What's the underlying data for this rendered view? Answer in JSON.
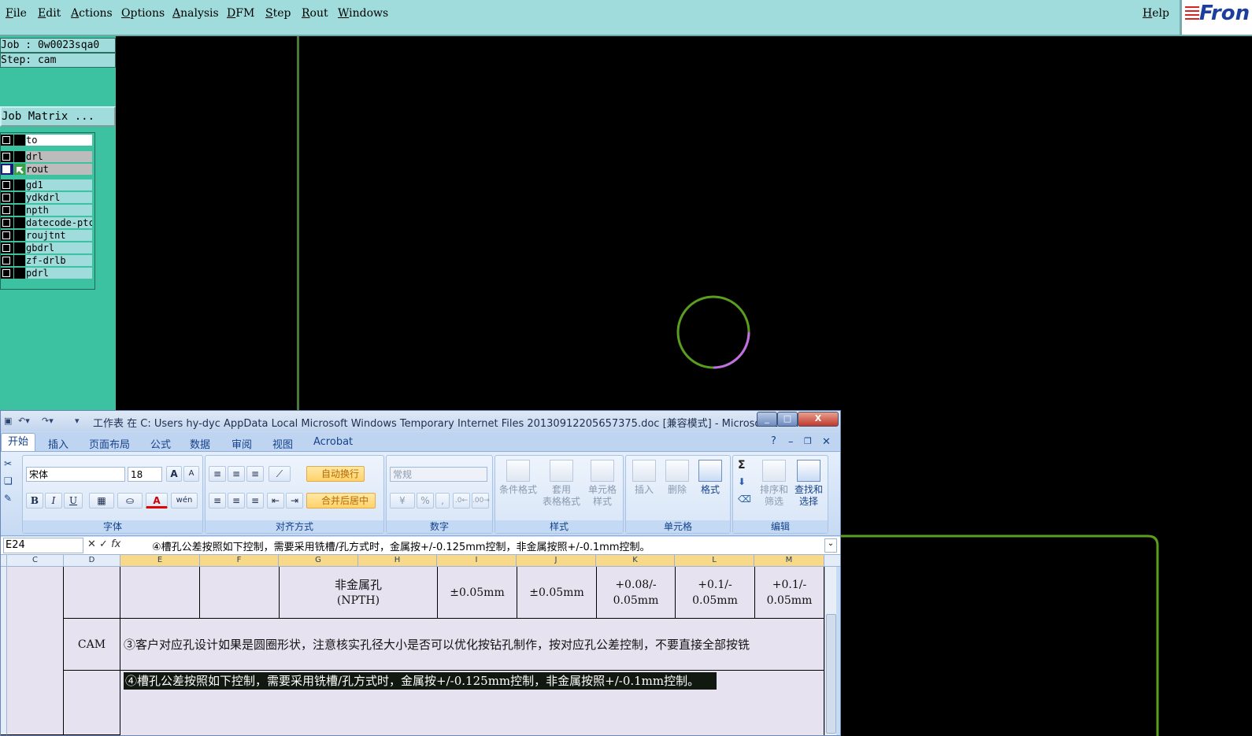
{
  "menubar": {
    "items": [
      "File",
      "Edit",
      "Actions",
      "Options",
      "Analysis",
      "DFM",
      "Step",
      "Rout",
      "Windows"
    ],
    "help": "Help",
    "logo_text": "Fron"
  },
  "left_panel": {
    "job": "Job : 0w0023sqa0",
    "step": "Step: cam",
    "job_matrix": "Job Matrix ...",
    "layers": [
      "to",
      "drl",
      "rout",
      "gd1",
      "ydkdrl",
      "npth",
      "datecode-ptc",
      "roujtnt",
      "gbdrl",
      "zf-drlb",
      "pdrl"
    ]
  },
  "excel": {
    "title": "工作表 在 C: Users hy-dyc AppData Local Microsoft Windows Temporary Internet Files 20130912205657375.doc [兼容模式] - Microsoft Excel",
    "window_buttons": {
      "min": "_",
      "max": "□",
      "close": "X"
    },
    "tabs": [
      "开始",
      "插入",
      "页面布局",
      "公式",
      "数据",
      "审阅",
      "视图",
      "Acrobat"
    ],
    "ribbon": {
      "font_name": "宋体",
      "font_size": "18",
      "grow_font": "A",
      "shrink_font": "A",
      "bold": "B",
      "italic": "I",
      "underline": "U",
      "font_color": "A",
      "wen": "wén",
      "wrap_text": "自动换行",
      "merge_center": "合并后居中",
      "number_format": "常规",
      "percent": "%",
      "comma": ",",
      "cond_format": "条件格式",
      "table_format_1": "套用",
      "table_format_2": "表格格式",
      "cell_style_1": "单元格",
      "cell_style_2": "样式",
      "insert": "插入",
      "delete": "删除",
      "format": "格式",
      "sum": "Σ",
      "sort_1": "排序和",
      "sort_2": "筛选",
      "find_1": "查找和",
      "find_2": "选择",
      "groups": [
        "字体",
        "对齐方式",
        "数字",
        "样式",
        "单元格",
        "编辑"
      ]
    },
    "namebox": "E24",
    "fx": "fx",
    "formula": "④槽孔公差按照如下控制，需要采用铣槽/孔方式时，金属按+/-0.125mm控制，非金属按照+/-0.1mm控制。",
    "columns": [
      "C",
      "D",
      "E",
      "F",
      "G",
      "H",
      "I",
      "J",
      "K",
      "L",
      "M"
    ],
    "rows": {
      "npth_1": "非金属孔",
      "npth_2": "(NPTH)",
      "i": "±0.05mm",
      "j": "±0.05mm",
      "k_1": "+0.08/-",
      "k_2": "0.05mm",
      "l_1": "+0.1/-",
      "l_2": "0.05mm",
      "m_1": "+0.1/-",
      "m_2": "0.05mm",
      "cam": "CAM",
      "note3": "③客户对应孔设计如果是圆圈形状，注意核实孔径大小是否可以优化按钻孔制作，按对应孔公差控制，不要直接全部按铣",
      "note4": "④槽孔公差按照如下控制，需要采用铣槽/孔方式时，金属按+/-0.125mm控制，非金属按照+/-0.1mm控制。"
    }
  },
  "colors": {
    "menubar_bg": "#a0dcdc",
    "panel_bg": "#3cc2a0",
    "canvas_bg": "#000000",
    "profile_green": "#5a9e1e",
    "arc_magenta": "#c46ee6"
  }
}
